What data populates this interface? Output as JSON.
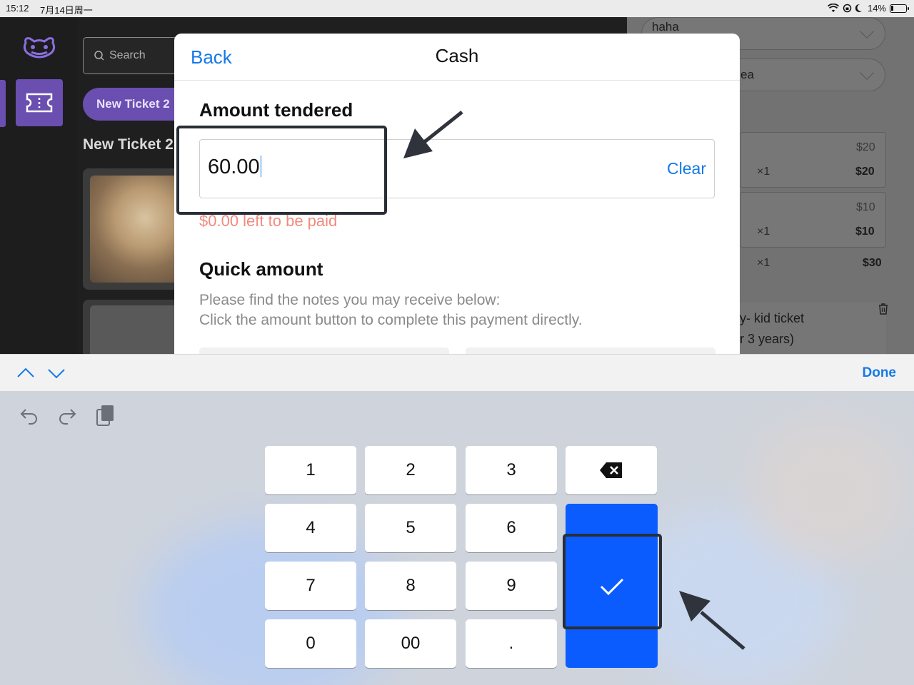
{
  "status_bar": {
    "time": "15:12",
    "date": "7月14日周一",
    "battery": "14%"
  },
  "background": {
    "search_placeholder": "Search",
    "new_ticket_button": "New Ticket 2",
    "new_ticket_title": "New Ticket 2",
    "right_panel": {
      "dropdown_1": "haha",
      "dropdown_2": "ea",
      "line_items": [
        {
          "price": "$20",
          "qty": "×1",
          "total": "$20"
        },
        {
          "price": "$10",
          "qty": "×1",
          "total": "$10"
        },
        {
          "qty": "×1",
          "total": "$30"
        }
      ],
      "ticket_name_line1": "y- kid ticket",
      "ticket_name_line2": "r 3 years)"
    }
  },
  "modal": {
    "back_label": "Back",
    "title": "Cash",
    "amount_label": "Amount tendered",
    "amount_value": "60.00",
    "clear_label": "Clear",
    "left_to_pay": "$0.00 left to be paid",
    "quick_amount_label": "Quick amount",
    "quick_desc_line1": "Please find the notes you may receive below:",
    "quick_desc_line2": "Click the amount button to complete this payment directly."
  },
  "keyboard": {
    "done_label": "Done",
    "keys": [
      "1",
      "2",
      "3",
      "4",
      "5",
      "6",
      "7",
      "8",
      "9",
      "0",
      "00",
      "."
    ],
    "accent_color": "#0a5cff"
  },
  "colors": {
    "link_blue": "#1479e8",
    "brand_purple": "#6a4fb0",
    "remaining_red": "#f28a7e"
  }
}
